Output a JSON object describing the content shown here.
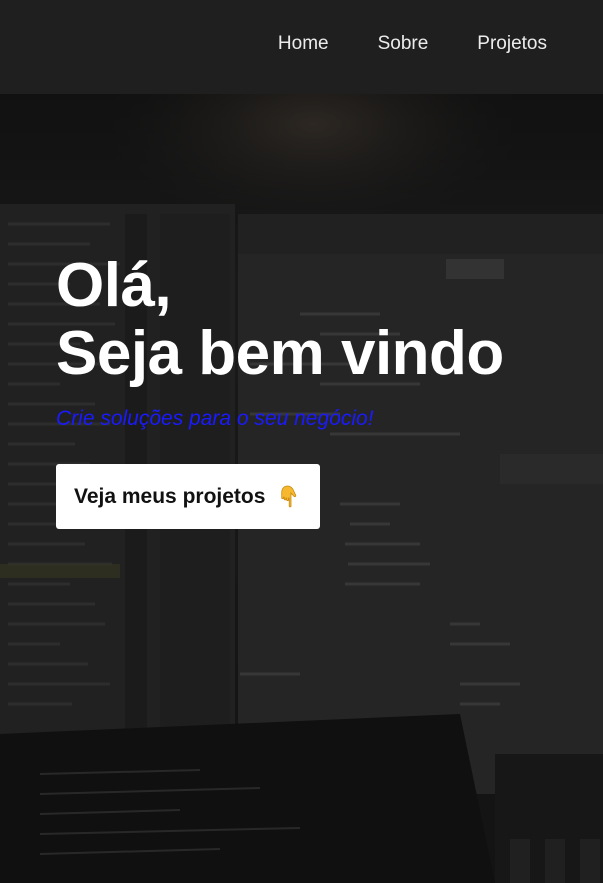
{
  "nav": {
    "items": [
      {
        "label": "Home"
      },
      {
        "label": "Sobre"
      },
      {
        "label": "Projetos"
      }
    ]
  },
  "hero": {
    "title_line1": "Olá,",
    "title_line2": "Seja bem vindo",
    "subtitle": "Crie soluções para o seu negócio!",
    "cta_label": "Veja meus projetos",
    "cta_icon": "pointing-down-hand-icon",
    "background": "code-editor-screens-photo"
  },
  "colors": {
    "nav_bg": "#1f1f1f",
    "nav_text": "#ececec",
    "title": "#ffffff",
    "subtitle": "#1a1aff",
    "cta_bg": "#ffffff",
    "cta_text": "#111111"
  }
}
